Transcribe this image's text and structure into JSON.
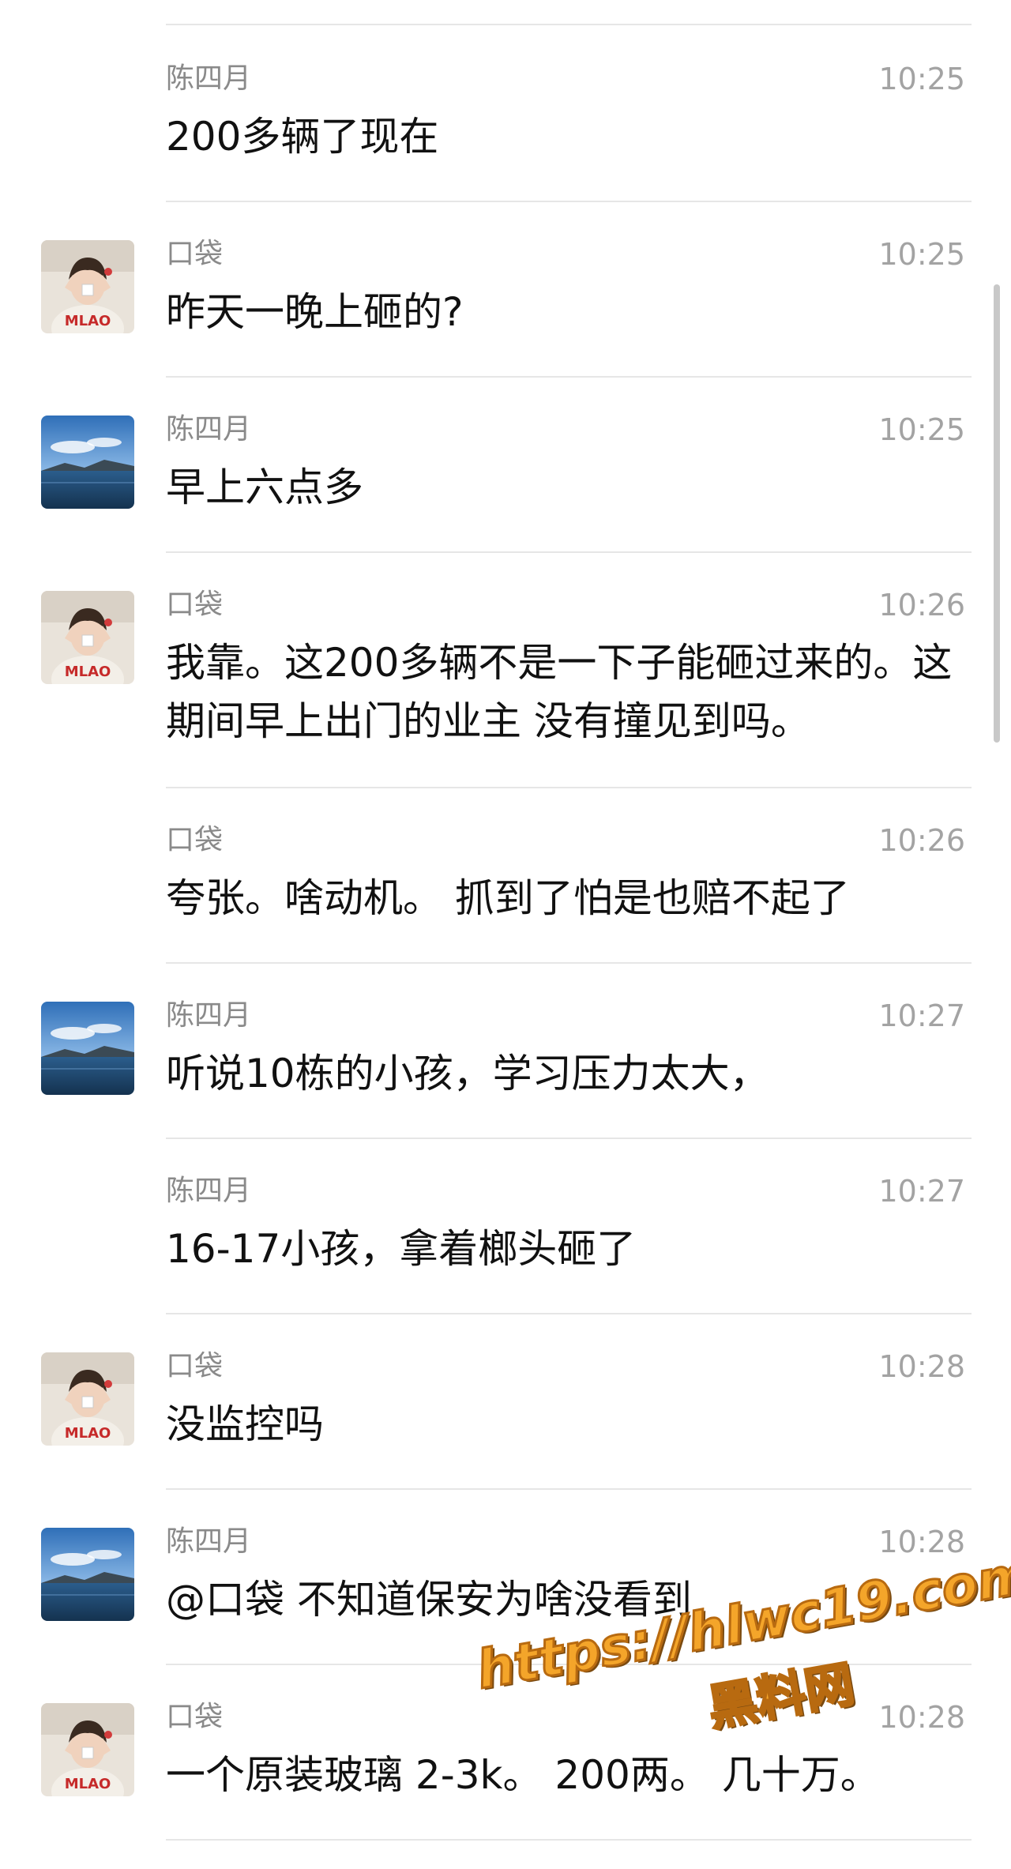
{
  "messages": [
    {
      "sender": "陈四月",
      "time": "10:25",
      "text": "200多辆了现在",
      "avatar": "none"
    },
    {
      "sender": "口袋",
      "time": "10:25",
      "text": "昨天一晚上砸的?",
      "avatar": "koudai"
    },
    {
      "sender": "陈四月",
      "time": "10:25",
      "text": "早上六点多",
      "avatar": "lake"
    },
    {
      "sender": "口袋",
      "time": "10:26",
      "text": "我靠。这200多辆不是一下子能砸过来的。这期间早上出门的业主 没有撞见到吗。",
      "avatar": "koudai"
    },
    {
      "sender": "口袋",
      "time": "10:26",
      "text": "夸张。啥动机。 抓到了怕是也赔不起了",
      "avatar": "none"
    },
    {
      "sender": "陈四月",
      "time": "10:27",
      "text": "听说10栋的小孩，学习压力太大，",
      "avatar": "lake"
    },
    {
      "sender": "陈四月",
      "time": "10:27",
      "text": "16-17小孩，拿着榔头砸了",
      "avatar": "none"
    },
    {
      "sender": "口袋",
      "time": "10:28",
      "text": "没监控吗",
      "avatar": "koudai"
    },
    {
      "sender": "陈四月",
      "time": "10:28",
      "text": "@口袋 不知道保安为啥没看到",
      "avatar": "lake"
    },
    {
      "sender": "口袋",
      "time": "10:28",
      "text": "一个原装玻璃 2-3k。 200两。 几十万。",
      "avatar": "koudai"
    }
  ],
  "watermark": {
    "url": "https://hlwc19.com",
    "site": "黑料网"
  },
  "colors": {
    "sender": "#8a8a8a",
    "time": "#a3a3a3",
    "text": "#111111",
    "divider": "#e6e6e6",
    "watermark": "#f4a52a"
  }
}
